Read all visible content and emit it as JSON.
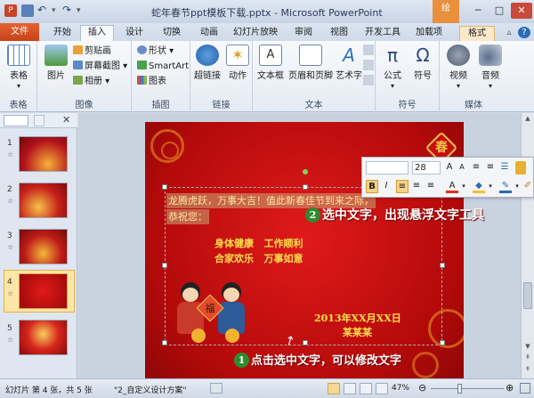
{
  "window": {
    "title": "蛇年春节ppt模板下载.pptx - Microsoft PowerPoint",
    "context_tab": "绘"
  },
  "tabs": [
    {
      "label": "文件"
    },
    {
      "label": "开始"
    },
    {
      "label": "插入"
    },
    {
      "label": "设计"
    },
    {
      "label": "切换"
    },
    {
      "label": "动画"
    },
    {
      "label": "幻灯片放映"
    },
    {
      "label": "审阅"
    },
    {
      "label": "视图"
    },
    {
      "label": "开发工具"
    },
    {
      "label": "加载项"
    },
    {
      "label": "格式"
    }
  ],
  "ribbon": {
    "groups": [
      {
        "label": "表格"
      },
      {
        "label": "图像"
      },
      {
        "label": "插图"
      },
      {
        "label": "链接"
      },
      {
        "label": "文本"
      },
      {
        "label": "符号"
      },
      {
        "label": "媒体"
      }
    ],
    "table": "表格",
    "picture": "图片",
    "clipart": "剪贴画",
    "screenshot": "屏幕截图",
    "album": "相册",
    "shapes": "形状",
    "smartart": "SmartArt",
    "chart": "图表",
    "hyperlink": "超链接",
    "action": "动作",
    "textbox": "文本框",
    "headerfooter": "页眉和页脚",
    "wordart": "艺术字",
    "equation": "公式",
    "symbol": "符号",
    "video": "视频",
    "audio": "音频",
    "pi": "π",
    "omega": "Ω"
  },
  "slides": [
    {
      "num": "1"
    },
    {
      "num": "2"
    },
    {
      "num": "3"
    },
    {
      "num": "4"
    },
    {
      "num": "5"
    }
  ],
  "slide": {
    "chun": "春",
    "line1": "龙腾虎跃，万事大吉！值此新春佳节到来之际，",
    "line2": "恭祝您：",
    "wish1": "身体健康   工作顺利",
    "wish2": "合家欢乐   万事如意",
    "date": "2013年XX月XX日",
    "name": "某某某",
    "fu": "福"
  },
  "annotations": {
    "step1_num": "1",
    "step1": "点击选中文字，可以修改文字",
    "step2_num": "2",
    "step2": "选中文字，出现悬浮文字工具"
  },
  "minitoolbar": {
    "font_size": "28",
    "bold": "B",
    "italic": "I",
    "font_color": "A"
  },
  "status": {
    "slide_info": "幻灯片 第 4 张，共 5 张",
    "theme": "\"2_自定义设计方案\"",
    "zoom": "47%"
  },
  "colors": {
    "file_tab": "#d24f22",
    "slide_red": "#c8101a",
    "gold_text": "#ffe14a",
    "annotation_green": "#2e8b2e"
  }
}
